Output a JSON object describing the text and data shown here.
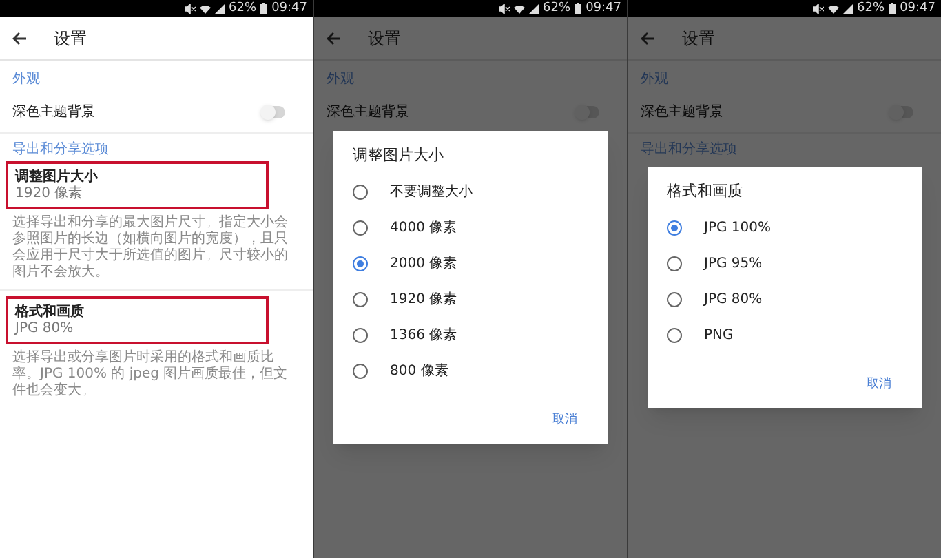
{
  "screens": [
    {
      "status_bar": {
        "battery": "62%",
        "time": "09:47"
      },
      "app_bar": {
        "title": "设置"
      },
      "sections": [
        {
          "header": "外观",
          "items": [
            {
              "kind": "toggle",
              "title": "深色主题背景",
              "on": false
            }
          ]
        },
        {
          "header": "导出和分享选项",
          "items": [
            {
              "kind": "option",
              "title": "调整图片大小",
              "value": "1920 像素",
              "highlighted": true,
              "description": "选择导出和分享的最大图片尺寸。指定大小会参照图片的长边（如横向图片的宽度），且只会应用于尺寸大于所选值的图片。尺寸较小的图片不会放大。"
            },
            {
              "kind": "option",
              "title": "格式和画质",
              "value": "JPG 80%",
              "highlighted": true,
              "description": "选择导出或分享图片时采用的格式和画质比率。JPG 100% 的 jpeg 图片画质最佳，但文件也会变大。"
            }
          ]
        }
      ]
    },
    {
      "status_bar": {
        "battery": "62%",
        "time": "09:47"
      },
      "app_bar": {
        "title": "设置"
      },
      "sections": [
        {
          "header": "外观",
          "items": [
            {
              "kind": "toggle",
              "title": "深色主题背景",
              "on": false
            }
          ]
        }
      ],
      "dialog": {
        "title": "调整图片大小",
        "options": [
          {
            "label": "不要调整大小",
            "selected": false
          },
          {
            "label": "4000 像素",
            "selected": false
          },
          {
            "label": "2000 像素",
            "selected": true
          },
          {
            "label": "1920 像素",
            "selected": false
          },
          {
            "label": "1366 像素",
            "selected": false
          },
          {
            "label": "800 像素",
            "selected": false
          }
        ],
        "cancel": "取消"
      }
    },
    {
      "status_bar": {
        "battery": "62%",
        "time": "09:47"
      },
      "app_bar": {
        "title": "设置"
      },
      "sections": [
        {
          "header": "外观",
          "items": [
            {
              "kind": "toggle",
              "title": "深色主题背景",
              "on": false
            }
          ]
        },
        {
          "header": "导出和分享选项"
        }
      ],
      "dialog": {
        "title": "格式和画质",
        "options": [
          {
            "label": "JPG 100%",
            "selected": true
          },
          {
            "label": "JPG 95%",
            "selected": false
          },
          {
            "label": "JPG 80%",
            "selected": false
          },
          {
            "label": "PNG",
            "selected": false
          }
        ],
        "cancel": "取消"
      }
    }
  ]
}
